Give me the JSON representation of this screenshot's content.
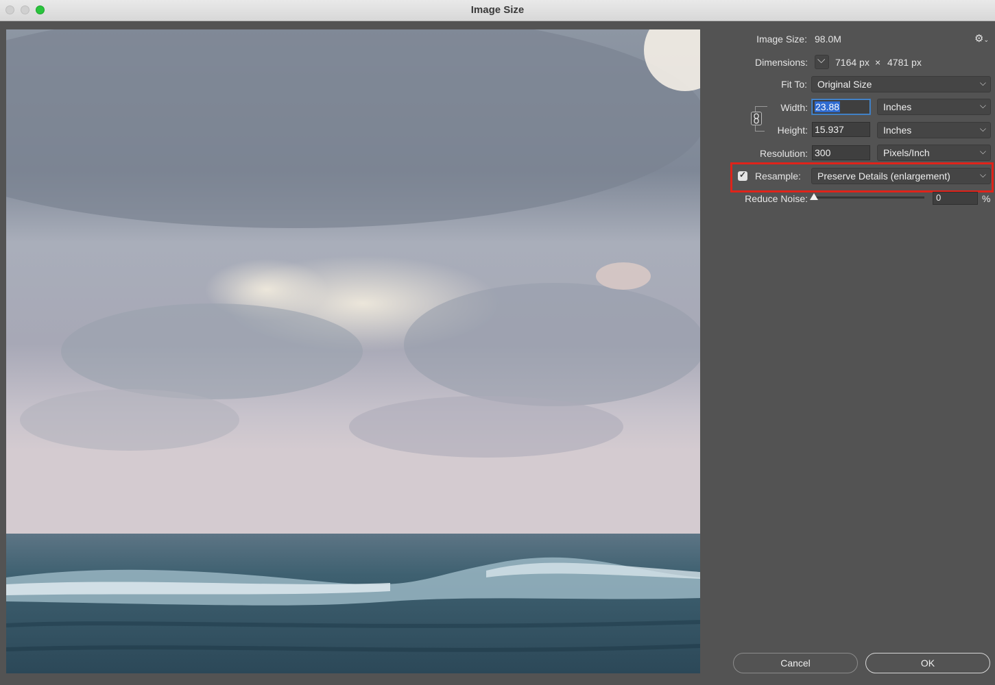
{
  "window": {
    "title": "Image Size"
  },
  "image_size": {
    "label": "Image Size:",
    "value": "98.0M"
  },
  "dimensions": {
    "label": "Dimensions:",
    "width": "7164 px",
    "times": "×",
    "height": "4781 px"
  },
  "fit_to": {
    "label": "Fit To:",
    "value": "Original Size"
  },
  "width": {
    "label": "Width:",
    "value": "23.88",
    "unit": "Inches"
  },
  "height": {
    "label": "Height:",
    "value": "15.937",
    "unit": "Inches"
  },
  "resolution": {
    "label": "Resolution:",
    "value": "300",
    "unit": "Pixels/Inch"
  },
  "resample": {
    "label": "Resample:",
    "checked": true,
    "value": "Preserve Details (enlargement)"
  },
  "reduce_noise": {
    "label": "Reduce Noise:",
    "value": "0",
    "unit": "%"
  },
  "buttons": {
    "cancel": "Cancel",
    "ok": "OK"
  },
  "colors": {
    "highlight": "#e0231a",
    "panel": "#535353",
    "selection": "#2f6bd0"
  },
  "icons": {
    "gear": "gear-icon",
    "chain": "chain-link-icon",
    "chevron": "chevron-down-icon",
    "check": "checkmark-icon"
  }
}
